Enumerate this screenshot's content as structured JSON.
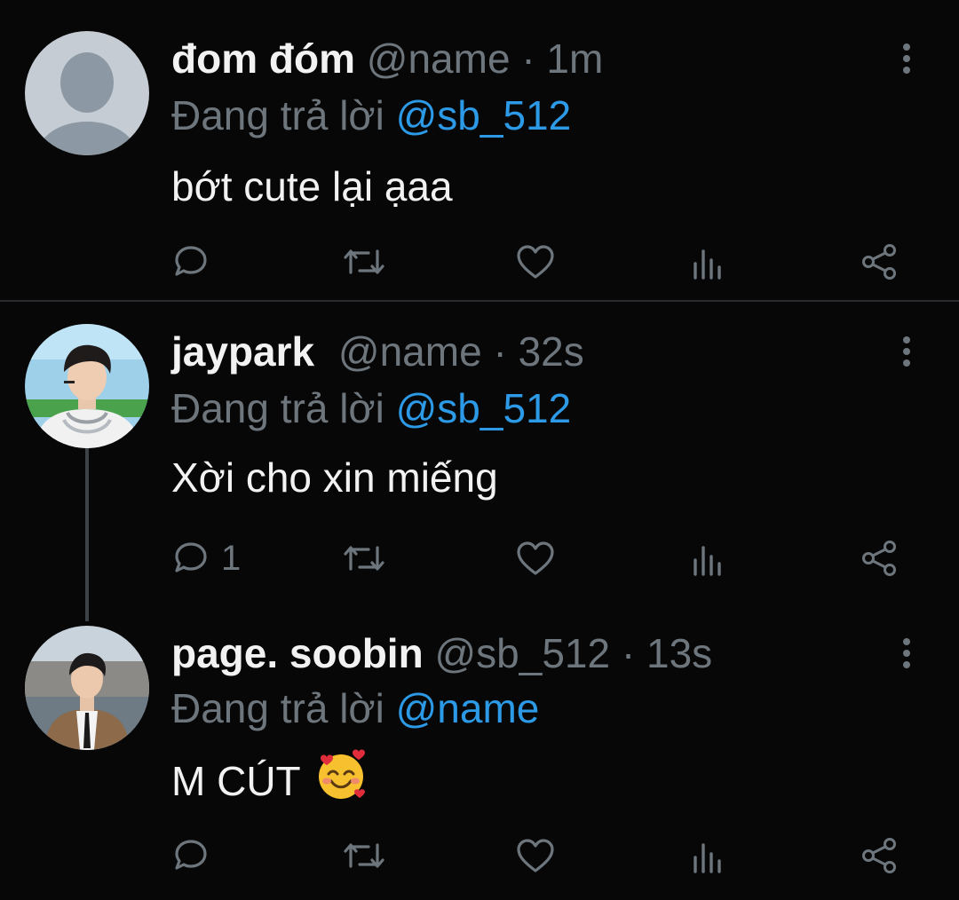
{
  "tweets": [
    {
      "display_name": "đom đóm",
      "handle": "@name",
      "sep": "·",
      "time": "1m",
      "reply_prefix": "Đang trả lời",
      "reply_to": "@sb_512",
      "text": "bớt cute lại ạaa",
      "avatar": "default-avatar-icon",
      "reply_count": ""
    },
    {
      "display_name": "jaypark",
      "handle": "@name",
      "sep": "·",
      "time": "32s",
      "reply_prefix": "Đang trả lời",
      "reply_to": "@sb_512",
      "text": "Xời cho xin miếng",
      "avatar": "user-photo",
      "reply_count": "1"
    },
    {
      "display_name": "page. soobin",
      "handle": "@sb_512",
      "sep": "·",
      "time": "13s",
      "reply_prefix": "Đang trả lời",
      "reply_to": "@name",
      "text": "M CÚT",
      "emoji": "smiling-face-with-hearts-emoji",
      "avatar": "user-photo",
      "reply_count": ""
    }
  ],
  "icons": {
    "reply": "reply-icon",
    "retweet": "retweet-icon",
    "like": "heart-icon",
    "analytics": "analytics-icon",
    "share": "share-icon",
    "more": "more-vertical-icon"
  },
  "colors": {
    "background": "#070707",
    "mention": "#2c9ae6",
    "muted": "#6e767d",
    "text": "#f2f2f2"
  }
}
